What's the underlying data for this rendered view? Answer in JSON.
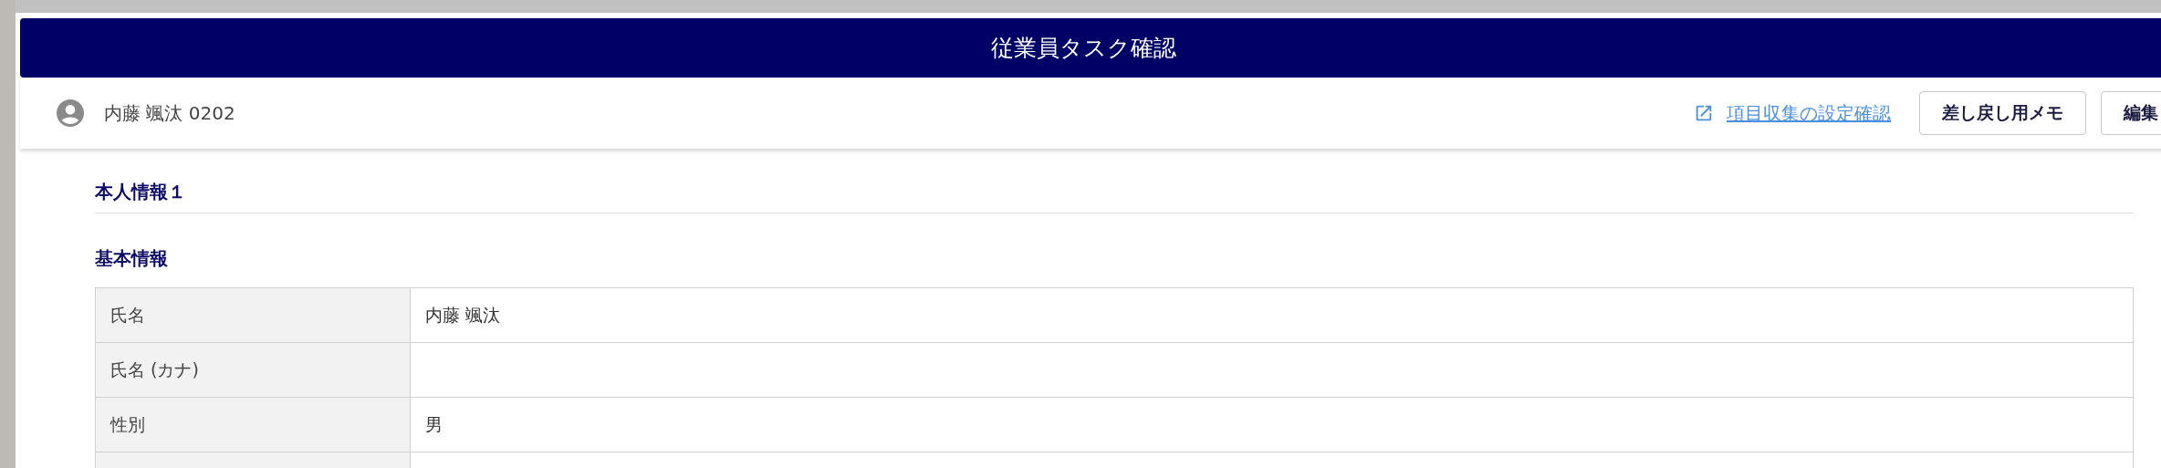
{
  "modal": {
    "title": "従業員タスク確認",
    "employee": {
      "name": "内藤 颯汰",
      "code": "0202"
    },
    "settings_link": "項目収集の設定確認",
    "buttons": [
      "差し戻し用メモ",
      "編集"
    ],
    "section_title": "本人情報１",
    "subsection_title": "基本情報",
    "rows": [
      {
        "label": "氏名",
        "value": "内藤 颯汰"
      },
      {
        "label": "氏名 (カナ)"
      },
      {
        "label": "性別",
        "value": "男"
      }
    ]
  }
}
